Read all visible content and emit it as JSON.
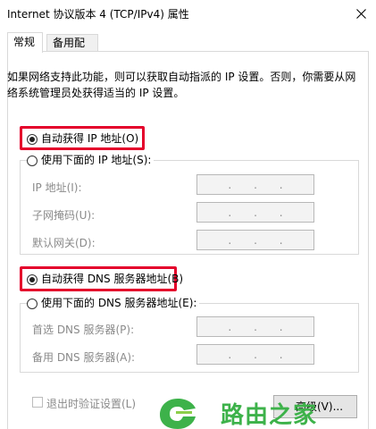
{
  "window": {
    "title": "Internet 协议版本 4 (TCP/IPv4) 属性"
  },
  "tabs": [
    {
      "label": "常规",
      "active": true
    },
    {
      "label": "备用配置",
      "active": false
    }
  ],
  "description": {
    "line1": "如果网络支持此功能，则可以获取自动指派的 IP 设置。否则，你需要从网",
    "line2": "络系统管理员处获得适当的 IP 设置。"
  },
  "ip": {
    "auto_label": "自动获得 IP 地址(O)",
    "manual_label": "使用下面的 IP 地址(S):",
    "fields": [
      {
        "label": "IP 地址(I):"
      },
      {
        "label": "子网掩码(U):"
      },
      {
        "label": "默认网关(D):"
      }
    ]
  },
  "dns": {
    "auto_label": "自动获得 DNS 服务器地址(B)",
    "manual_label": "使用下面的 DNS 服务器地址(E):",
    "fields": [
      {
        "label": "首选 DNS 服务器(P):"
      },
      {
        "label": "备用 DNS 服务器(A):"
      }
    ]
  },
  "footer": {
    "validate_label": "退出时验证设置(L)",
    "advanced_label": "高级(V)..."
  },
  "watermark": {
    "text": "路由之家"
  },
  "colors": {
    "highlight": "#e4002b",
    "watermark": "#3db24a"
  }
}
